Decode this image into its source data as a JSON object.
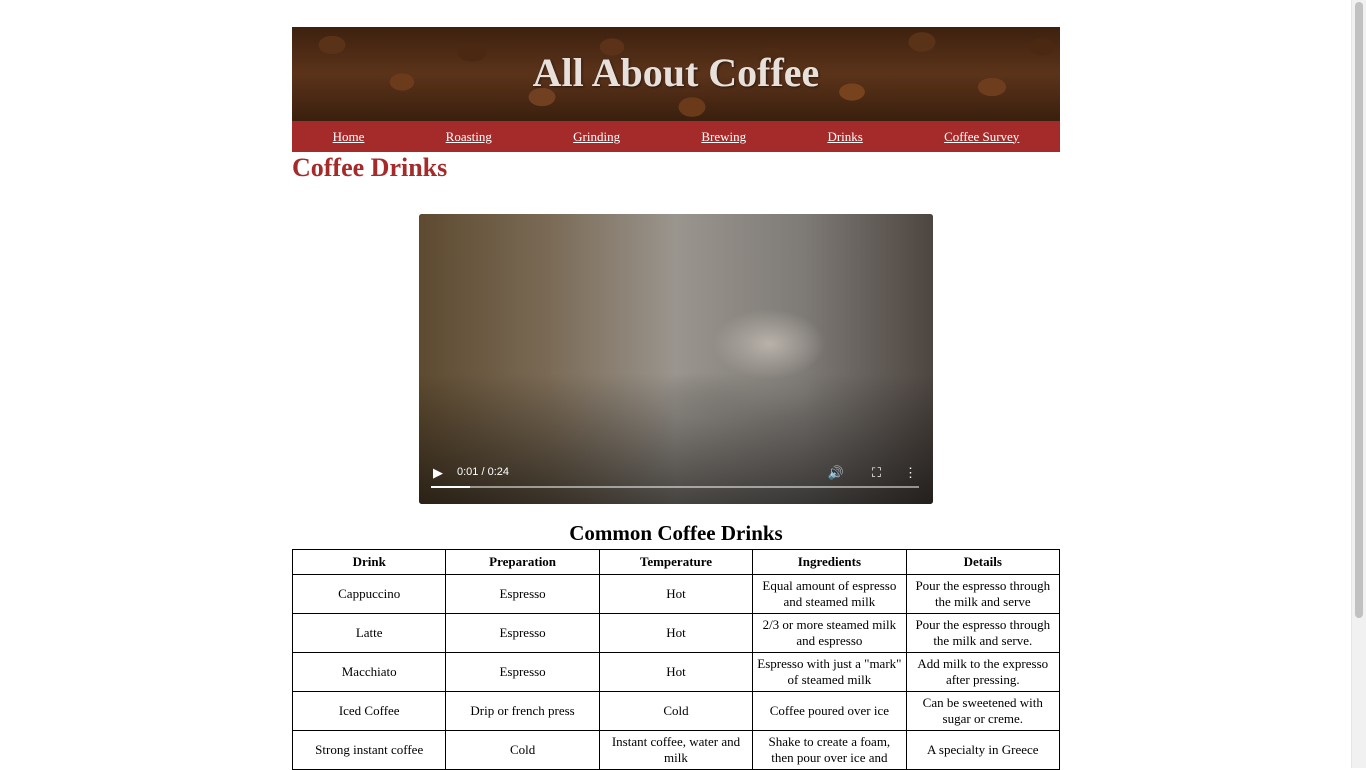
{
  "site_title": "All About Coffee",
  "nav": [
    {
      "label": "Home"
    },
    {
      "label": "Roasting"
    },
    {
      "label": "Grinding"
    },
    {
      "label": "Brewing"
    },
    {
      "label": "Drinks"
    },
    {
      "label": "Coffee Survey"
    }
  ],
  "page_title": "Coffee Drinks",
  "video": {
    "time_display": "0:01 / 0:24",
    "progress_fraction": 0.08,
    "icons": [
      "play-icon",
      "volume-icon",
      "fullscreen-icon",
      "more-options-icon"
    ]
  },
  "table": {
    "title": "Common Coffee Drinks",
    "headers": [
      "Drink",
      "Preparation",
      "Temperature",
      "Ingredients",
      "Details"
    ],
    "rows": [
      [
        "Cappuccino",
        "Espresso",
        "Hot",
        "Equal amount of espresso and steamed milk",
        "Pour the espresso through the milk and serve"
      ],
      [
        "Latte",
        "Espresso",
        "Hot",
        "2/3 or more steamed milk and espresso",
        "Pour the espresso through the milk and serve."
      ],
      [
        "Macchiato",
        "Espresso",
        "Hot",
        "Espresso with just a \"mark\" of steamed milk",
        "Add milk to the expresso after pressing."
      ],
      [
        "Iced Coffee",
        "Drip or french press",
        "Cold",
        "Coffee poured over ice",
        "Can be sweetened with sugar or creme."
      ],
      [
        "Strong instant coffee",
        "Cold",
        "Instant coffee, water and milk",
        "Shake to create a foam, then pour over ice and",
        "A specialty in Greece"
      ]
    ]
  },
  "colors": {
    "accent": "#a52a2a",
    "nav_text": "#ffffff"
  }
}
